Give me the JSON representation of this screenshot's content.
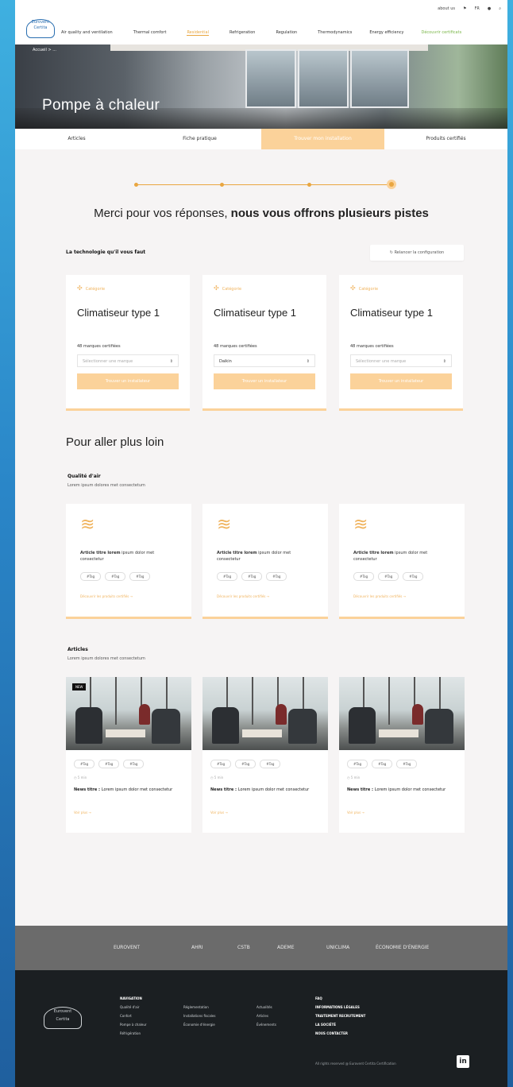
{
  "utility_bar": {
    "about": "about us",
    "lang": "FR",
    "search_icon": "search-icon",
    "user_icon": "user-icon",
    "globe_icon": "globe-icon"
  },
  "logo": {
    "line1": "Eurovent",
    "line2": "Certita"
  },
  "nav": {
    "items": [
      {
        "label": "Air quality and ventilation"
      },
      {
        "label": "Thermal comfort"
      },
      {
        "label": "Residential"
      },
      {
        "label": "Refrigeration"
      },
      {
        "label": "Regulation"
      },
      {
        "label": "Thermodynamics"
      },
      {
        "label": "Energy efficiency"
      },
      {
        "label": "Découvrir certificats"
      }
    ]
  },
  "hero": {
    "breadcrumb": "Accueil  >  ...",
    "title": "Pompe à chaleur"
  },
  "tabs": [
    {
      "label": "Articles"
    },
    {
      "label": "Fiche pratique"
    },
    {
      "label": "Trouver mon installation"
    },
    {
      "label": "Produits certifiés"
    }
  ],
  "merci": {
    "regular": "Merci pour vos réponses, ",
    "bold": "nous vous offrons plusieurs pistes"
  },
  "techno": {
    "heading": "La technologie qu'il vous faut",
    "reset_label": "Relancer la configuration"
  },
  "product_cards": [
    {
      "tag": "Catégorie",
      "title": "Climatiseur type 1",
      "count": "48 marques certifiées",
      "select": "Sélectionner une marque",
      "button": "Trouver un installateur"
    },
    {
      "tag": "Catégorie",
      "title": "Climatiseur type 1",
      "count": "48 marques certifiées",
      "select": "Daikin",
      "button": "Trouver un installateur"
    },
    {
      "tag": "Catégorie",
      "title": "Climatiseur type 1",
      "count": "48 marques certifiées",
      "select": "Sélectionner une marque",
      "button": "Trouver un installateur"
    }
  ],
  "further": {
    "heading": "Pour aller plus loin"
  },
  "air_quality": {
    "heading": "Qualité d'air",
    "sub": "Lorem ipsum dolores met consectetum",
    "cards": [
      {
        "bold": "Article titre lorem",
        "text": " ipsum dolor met consectetur",
        "pills": [
          "#Tag",
          "#Tag",
          "#Tag"
        ],
        "link": "Découvrir les produits certifiés  →"
      },
      {
        "bold": "Article titre lorem",
        "text": " ipsum dolor met consectetur",
        "pills": [
          "#Tag",
          "#Tag",
          "#Tag"
        ],
        "link": "Découvrir les produits certifiés  →"
      },
      {
        "bold": "Article titre lorem",
        "text": " ipsum dolor met consectetur",
        "pills": [
          "#Tag",
          "#Tag",
          "#Tag"
        ],
        "link": "Découvrir les produits certifiés  →"
      }
    ]
  },
  "articles": {
    "heading": "Articles",
    "sub": "Lorem ipsum dolores met consectetum",
    "cards": [
      {
        "badge": "NEW",
        "pills": [
          "#Tag",
          "#Tag",
          "#Tag"
        ],
        "meta": "5 min",
        "bold": "News titre : ",
        "text": "Lorem ipsum dolor met consectetur",
        "link": "Voir plus  →"
      },
      {
        "badge": "",
        "pills": [
          "#Tag",
          "#Tag",
          "#Tag"
        ],
        "meta": "5 min",
        "bold": "News titre : ",
        "text": "Lorem ipsum dolor met consectetur",
        "link": "Voir plus  →"
      },
      {
        "badge": "",
        "pills": [
          "#Tag",
          "#Tag",
          "#Tag"
        ],
        "meta": "5 min",
        "bold": "News titre : ",
        "text": "Lorem ipsum dolor met consectetur",
        "link": "Voir plus  →"
      }
    ]
  },
  "partners": [
    "EUROVENT",
    "AHRI",
    "CSTB",
    "ADEME",
    "UNICLIMA",
    "ÉCONOMIE D'ÉNERGIE"
  ],
  "footer": {
    "nav_heading": "NAVIGATION",
    "col1": [
      "Qualité d'air",
      "Confort",
      "Pompe à chaleur",
      "Réfrigération"
    ],
    "col2": [
      "Réglementation",
      "Installations fiscales",
      "Économie d'énergie"
    ],
    "col3": [
      "Actualités",
      "Articles",
      "Événements"
    ],
    "col4": [
      "FAQ",
      "INFORMATIONS LÉGALES",
      "TRAITEMENT RECRUTEMENT",
      "LA SOCIÉTÉ",
      "NOUS CONTACTER"
    ],
    "copyright": "All rights reserved @ Eurovent Certita Certification",
    "linkedin": "in"
  }
}
